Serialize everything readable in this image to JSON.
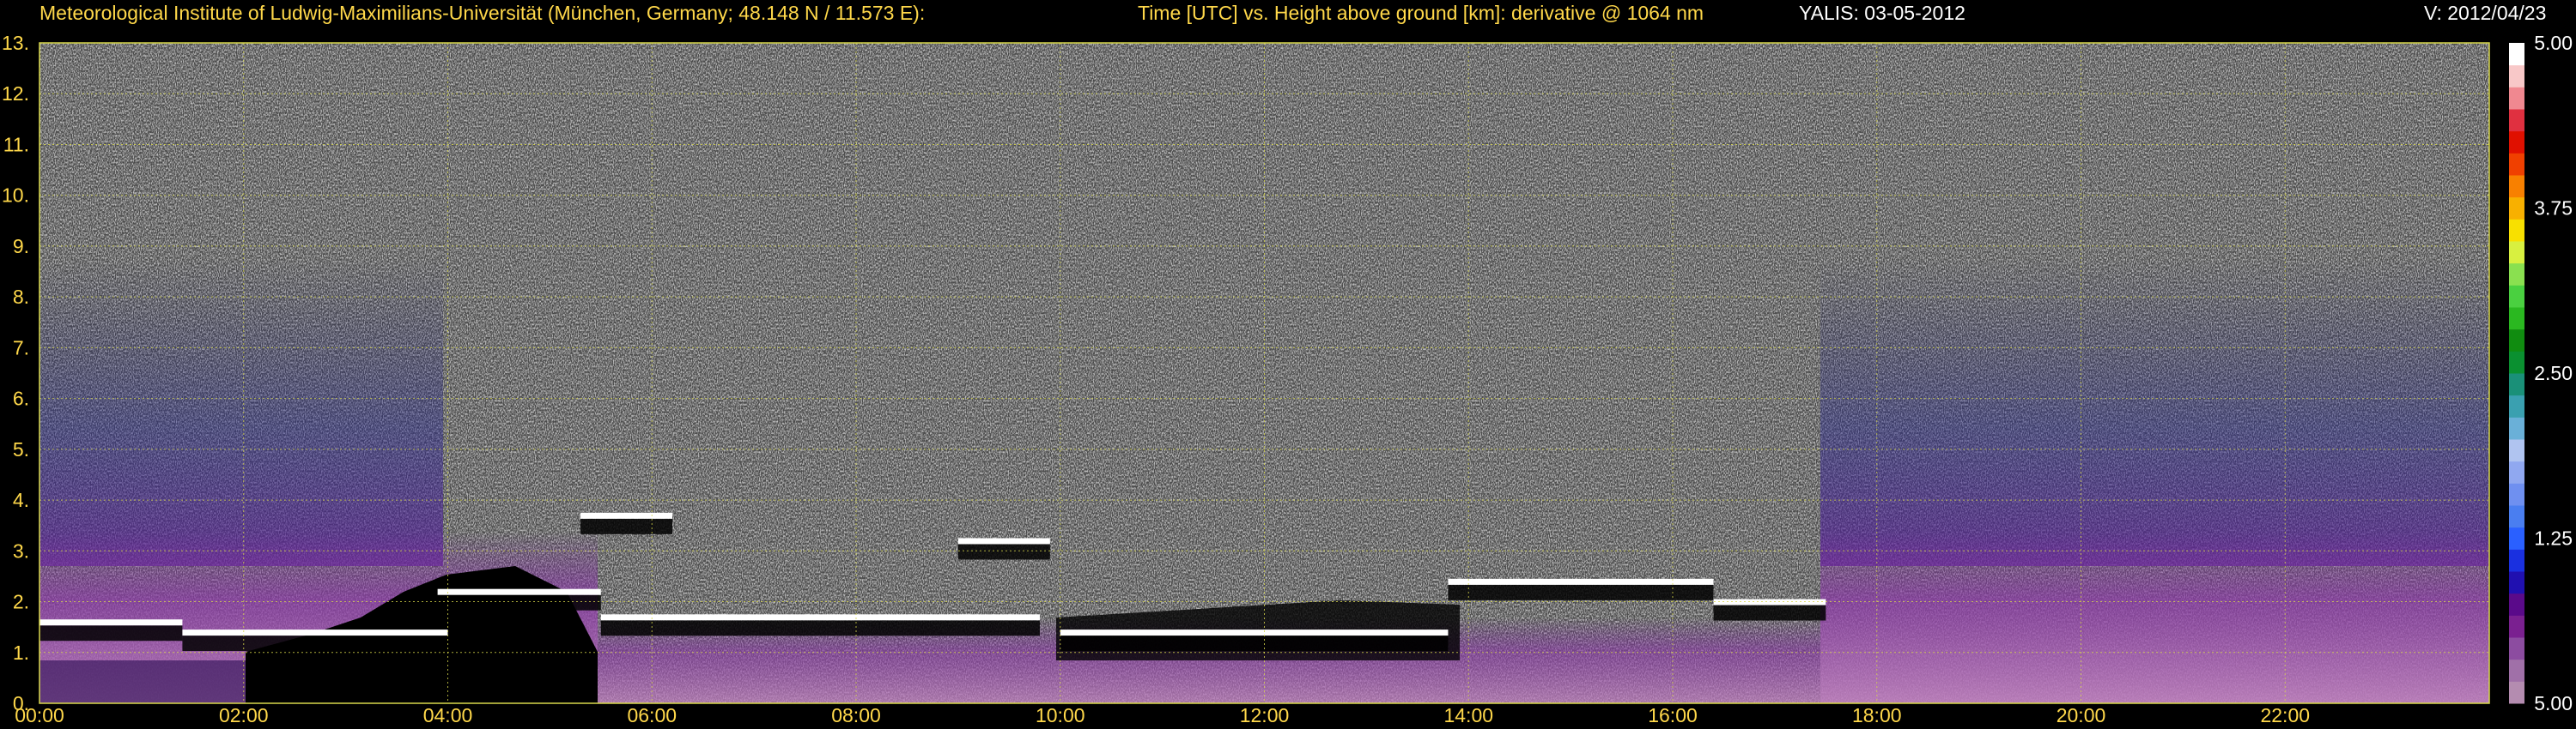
{
  "header": {
    "institute": "Meteorological Institute of Ludwig-Maximilians-Universität (München, Germany; 48.148 N / 11.573 E):",
    "plot_desc": "Time [UTC] vs. Height above ground [km]: derivative @ 1064 nm",
    "instrument_date": "YALIS: 03-05-2012",
    "version": "V: 2012/04/23"
  },
  "colors": {
    "label_text": "#ffd84a",
    "gridline": "#d8d84a",
    "background": "#000000",
    "colorbar": [
      "#b48cb0",
      "#a070a8",
      "#8c4ca0",
      "#7a2090",
      "#5a0a8a",
      "#2010b0",
      "#1a30e0",
      "#2a60ff",
      "#4a7ef0",
      "#6f90f0",
      "#90a8f0",
      "#b0c4f0",
      "#6ab0d8",
      "#3aa0b0",
      "#1a9078",
      "#0a9030",
      "#108c10",
      "#2ab820",
      "#4ad040",
      "#8ae050",
      "#d8f040",
      "#f8e000",
      "#f8b000",
      "#f88000",
      "#f04000",
      "#e01000",
      "#e03040",
      "#f08890",
      "#f8c8c8",
      "#ffffff"
    ]
  },
  "chart_data": {
    "type": "heatmap",
    "title": "Time [UTC] vs. Height above ground [km]: derivative @ 1064 nm",
    "xlabel": "Time [UTC]",
    "ylabel": "Height above ground [km]",
    "x_ticks": [
      "00:00",
      "02:00",
      "04:00",
      "06:00",
      "08:00",
      "10:00",
      "12:00",
      "14:00",
      "16:00",
      "18:00",
      "20:00",
      "22:00"
    ],
    "x_range_hours": [
      0,
      24
    ],
    "y_ticks": [
      "0.",
      "1.",
      "2.",
      "3.",
      "4.",
      "5.",
      "6.",
      "7.",
      "8.",
      "9.",
      "10.",
      "11.",
      "12.",
      "13."
    ],
    "ylim": [
      0,
      13
    ],
    "colorbar": {
      "labels": [
        "5.00",
        "3.75",
        "2.50",
        "1.25",
        "5.00"
      ]
    },
    "grid": true,
    "layers": [
      {
        "time_start": 0.0,
        "time_end": 1.4,
        "height_km": 1.6
      },
      {
        "time_start": 1.4,
        "time_end": 4.0,
        "height_km": 1.4
      },
      {
        "time_start": 3.9,
        "time_end": 5.5,
        "height_km": 2.2
      },
      {
        "time_start": 5.5,
        "time_end": 9.8,
        "height_km": 1.7
      },
      {
        "time_start": 10.0,
        "time_end": 13.8,
        "height_km": 1.4
      },
      {
        "time_start": 13.8,
        "time_end": 16.4,
        "height_km": 2.4
      },
      {
        "time_start": 16.4,
        "time_end": 17.5,
        "height_km": 2.0
      },
      {
        "time_start": 9.0,
        "time_end": 9.9,
        "height_km": 3.2
      },
      {
        "time_start": 5.3,
        "time_end": 6.2,
        "height_km": 3.7
      }
    ]
  }
}
